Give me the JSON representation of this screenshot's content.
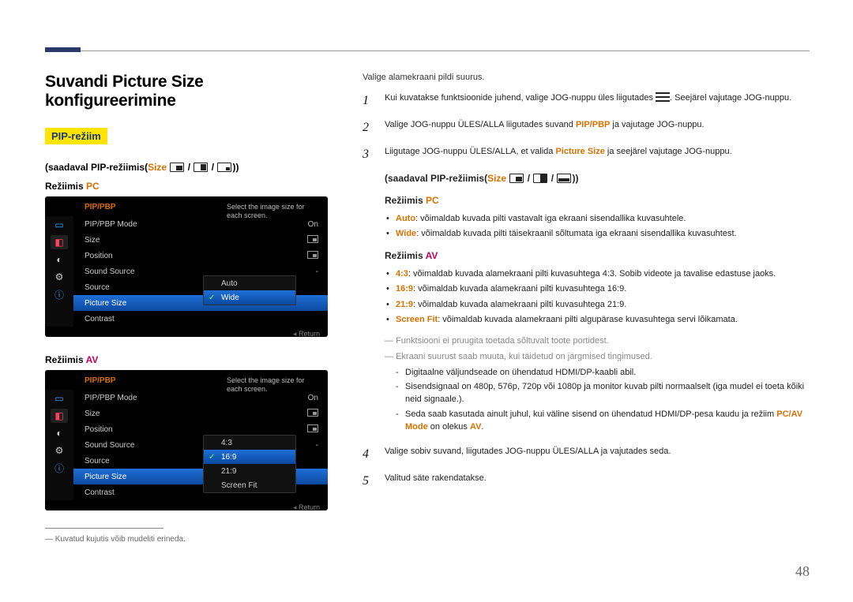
{
  "page_number": "48",
  "title": "Suvandi Picture Size konfigureerimine",
  "pip_badge": "PIP-režiim",
  "avail1_prefix": "(saadaval PIP-režiimis(",
  "avail1_size": "Size",
  "avail1_suffix": "))",
  "mode_pc_prefix": "Režiimis ",
  "mode_pc": "PC",
  "mode_av_prefix": "Režiimis ",
  "mode_av": "AV",
  "osd": {
    "header": "PIP/PBP",
    "desc": "Select the image size for each screen.",
    "items": {
      "mode": "PIP/PBP Mode",
      "mode_val": "On",
      "size": "Size",
      "position": "Position",
      "sound": "Sound Source",
      "source": "Source",
      "psize": "Picture Size",
      "contrast": "Contrast"
    },
    "dash": "-",
    "pc_opts": {
      "auto": "Auto",
      "wide": "Wide"
    },
    "av_opts": {
      "r43": "4:3",
      "r169": "16:9",
      "r219": "21:9",
      "fit": "Screen Fit"
    },
    "return": "Return"
  },
  "left_footnote": "Kuvatud kujutis võib mudeliti erineda.",
  "intro": "Valige alamekraani pildi suurus.",
  "step1a": "Kui kuvatakse funktsioonide juhend, valige JOG-nuppu üles liigutades ",
  "step1b": ". Seejärel vajutage JOG-nuppu.",
  "step2a": "Valige JOG-nuppu ÜLES/ALLA liigutades suvand ",
  "step2_pipbp": "PIP/PBP",
  "step2b": " ja vajutage JOG-nuppu.",
  "step3a": "Liigutage JOG-nuppu ÜLES/ALLA, et valida ",
  "step3_ps": "Picture Size",
  "step3b": " ja seejärel vajutage JOG-nuppu.",
  "r_avail_prefix": "(saadaval PIP-režiimis(",
  "r_avail_size": "Size",
  "r_avail_suffix": "))",
  "r_pc_prefix": "Režiimis ",
  "r_pc": "PC",
  "pc_auto_k": "Auto",
  "pc_auto_v": ": võimaldab kuvada pilti vastavalt iga ekraani sisendallika kuvasuhtele.",
  "pc_wide_k": "Wide",
  "pc_wide_v": ": võimaldab kuvada pilti täisekraanil sõltumata iga ekraani sisendallika kuvasuhtest.",
  "r_av_prefix": "Režiimis ",
  "r_av": "AV",
  "av_43_k": "4:3",
  "av_43_v": ": võimaldab kuvada alamekraani pilti kuvasuhtega 4:3. Sobib videote ja tavalise edastuse jaoks.",
  "av_169_k": "16:9",
  "av_169_v": ": võimaldab kuvada alamekraani pilti kuvasuhtega 16:9.",
  "av_219_k": "21:9",
  "av_219_v": ": võimaldab kuvada alamekraani pilti kuvasuhtega 21:9.",
  "av_fit_k": "Screen Fit",
  "av_fit_v": ": võimaldab kuvada alamekraani pilti algupärase kuvasuhtega servi lõikamata.",
  "note1": "Funktsiooni ei pruugita toetada sõltuvalt toote portidest.",
  "note2": "Ekraani suurust saab muuta, kui täidetud on järgmised tingimused.",
  "sub1": "Digitaalne väljundseade on ühendatud HDMI/DP-kaabli abil.",
  "sub2": "Sisendsignaal on 480p, 576p, 720p või 1080p ja monitor kuvab pilti normaalselt (iga mudel ei toeta kõiki neid signaale.).",
  "sub3a": "Seda saab kasutada ainult juhul, kui väline sisend on ühendatud HDMI/DP-pesa kaudu ja režiim ",
  "sub3_mode": "PC/AV Mode",
  "sub3b": " on olekus ",
  "sub3_av": "AV",
  "sub3c": ".",
  "step4": "Valige sobiv suvand, liigutades JOG-nuppu ÜLES/ALLA ja vajutades seda.",
  "step5": "Valitud säte rakendatakse."
}
